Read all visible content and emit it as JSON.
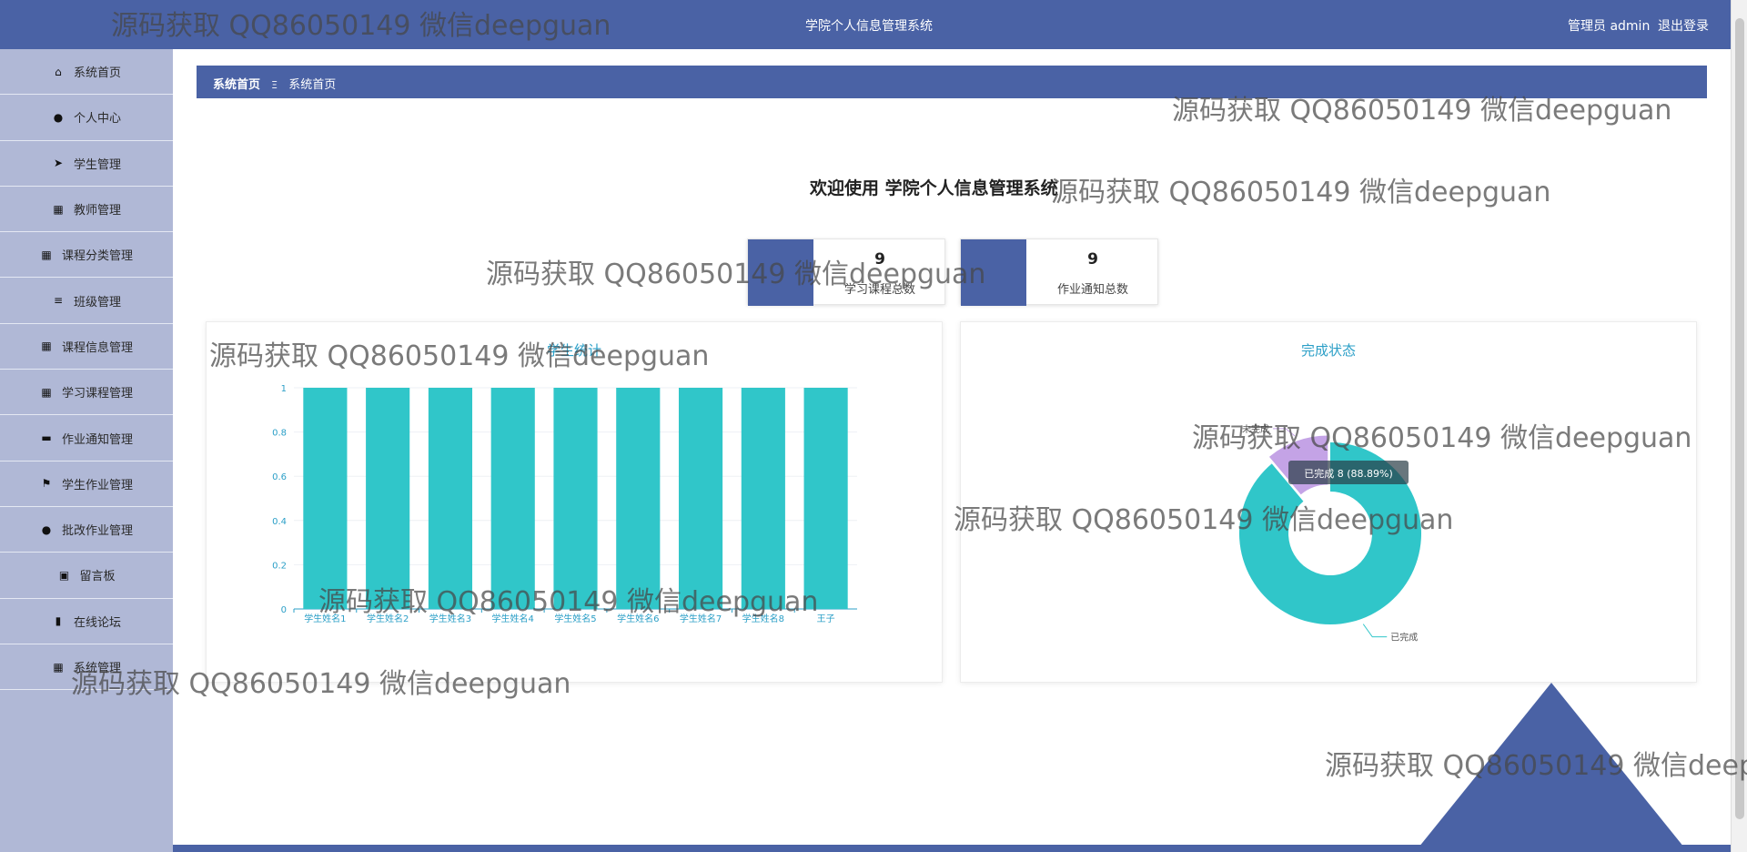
{
  "header": {
    "title": "学院个人信息管理系统",
    "user": "管理员 admin",
    "logout": "退出登录"
  },
  "sidebar": {
    "items": [
      {
        "label": "系统首页",
        "icon": "home-icon",
        "glyph": "⌂"
      },
      {
        "label": "个人中心",
        "icon": "user-icon",
        "glyph": "●"
      },
      {
        "label": "学生管理",
        "icon": "paper-plane-icon",
        "glyph": "➤"
      },
      {
        "label": "教师管理",
        "icon": "grid-icon",
        "glyph": "▦"
      },
      {
        "label": "课程分类管理",
        "icon": "grid-icon",
        "glyph": "▦"
      },
      {
        "label": "班级管理",
        "icon": "list-icon",
        "glyph": "≡"
      },
      {
        "label": "课程信息管理",
        "icon": "grid-icon",
        "glyph": "▦"
      },
      {
        "label": "学习课程管理",
        "icon": "grid-icon",
        "glyph": "▦"
      },
      {
        "label": "作业通知管理",
        "icon": "printer-icon",
        "glyph": "▬"
      },
      {
        "label": "学生作业管理",
        "icon": "flag-icon",
        "glyph": "⚑"
      },
      {
        "label": "批改作业管理",
        "icon": "pin-icon",
        "glyph": "●"
      },
      {
        "label": "留言板",
        "icon": "clipboard-icon",
        "glyph": "▣"
      },
      {
        "label": "在线论坛",
        "icon": "book-icon",
        "glyph": "▮"
      },
      {
        "label": "系统管理",
        "icon": "grid-icon",
        "glyph": "▦"
      }
    ]
  },
  "breadcrumb": {
    "home": "系统首页",
    "sep": "Ξ",
    "current": "系统首页"
  },
  "welcome": "欢迎使用 学院个人信息管理系统",
  "stats": [
    {
      "value": "9",
      "label": "学习课程总数"
    },
    {
      "value": "9",
      "label": "作业通知总数"
    }
  ],
  "bar_panel": {
    "title": "学生统计"
  },
  "pie_panel": {
    "title": "完成状态",
    "tooltip": "已完成 8 (88.89%)"
  },
  "chart_data": [
    {
      "type": "bar",
      "categories": [
        "学生姓名1",
        "学生姓名2",
        "学生姓名3",
        "学生姓名4",
        "学生姓名5",
        "学生姓名6",
        "学生姓名7",
        "学生姓名8",
        "王子"
      ],
      "values": [
        1,
        1,
        1,
        1,
        1,
        1,
        1,
        1,
        1
      ],
      "yticks": [
        "0",
        "0.2",
        "0.4",
        "0.6",
        "0.8",
        "1"
      ],
      "ylim": [
        0,
        1
      ],
      "color": "#30c6c9"
    },
    {
      "type": "pie",
      "slices": [
        {
          "name": "已完成",
          "value": 8,
          "color": "#30c6c9"
        },
        {
          "name": "未完成",
          "value": 1,
          "color": "#c4a3e6"
        }
      ]
    }
  ],
  "watermark": "源码获取 QQ86050149 微信deepguan"
}
